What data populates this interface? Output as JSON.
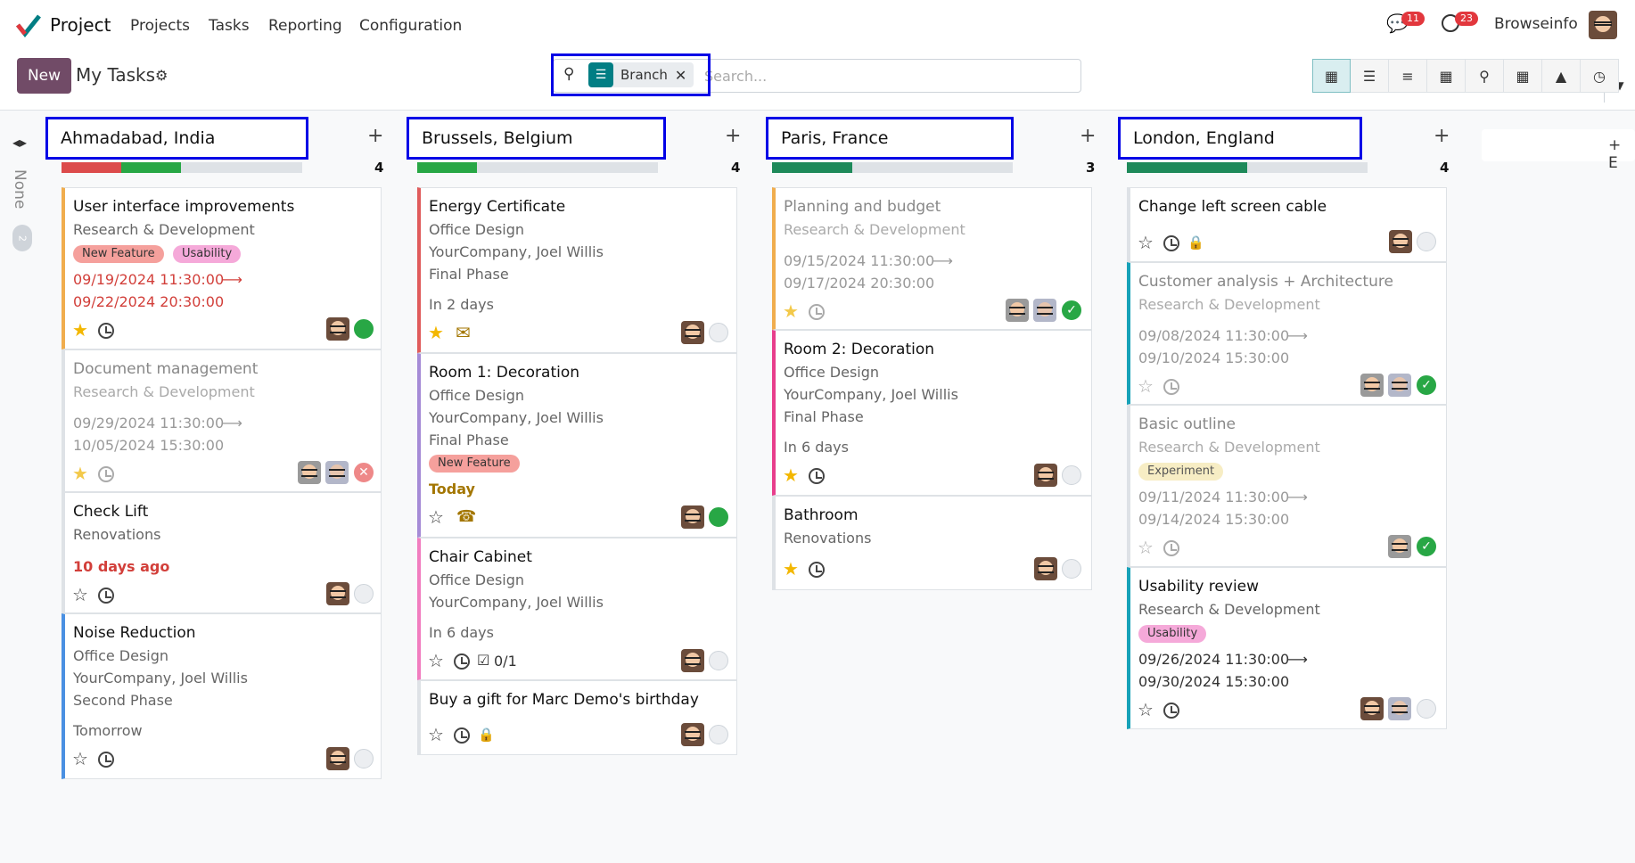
{
  "nav": {
    "app_name": "Project",
    "menu": [
      "Projects",
      "Tasks",
      "Reporting",
      "Configuration"
    ],
    "messages_count": "11",
    "activities_count": "23",
    "user": "Browseinfo"
  },
  "control": {
    "new_label": "New",
    "title": "My Tasks",
    "facet_label": "Branch",
    "search_placeholder": "Search...",
    "views": [
      "kanban",
      "list",
      "gantt",
      "calendar",
      "map",
      "pivot",
      "graph",
      "activity"
    ]
  },
  "none_column": {
    "label": "None",
    "count": "2"
  },
  "add_column_label": "+ E",
  "columns": [
    {
      "name": "Ahmadabad, India",
      "count": "4",
      "cards": [
        {
          "title": "User interface improvements",
          "lines": [
            "Research & Development"
          ],
          "tags": [
            "New Feature",
            "Usability"
          ],
          "date_start": "09/19/2024 11:30:00",
          "date_end": "09/22/2024 20:30:00"
        },
        {
          "title": "Document management",
          "lines": [
            "Research & Development"
          ],
          "date_start": "09/29/2024 11:30:00",
          "date_end": "10/05/2024 15:30:00"
        },
        {
          "title": "Check Lift",
          "lines": [
            "Renovations"
          ],
          "deadline": "10 days ago"
        },
        {
          "title": "Noise Reduction",
          "lines": [
            "Office Design",
            "YourCompany, Joel Willis",
            "Second Phase"
          ],
          "deadline": "Tomorrow"
        }
      ]
    },
    {
      "name": "Brussels, Belgium",
      "count": "4",
      "cards": [
        {
          "title": "Energy Certificate",
          "lines": [
            "Office Design",
            "YourCompany, Joel Willis",
            "Final Phase"
          ],
          "deadline": "In 2 days"
        },
        {
          "title": "Room 1: Decoration",
          "lines": [
            "Office Design",
            "YourCompany, Joel Willis",
            "Final Phase"
          ],
          "tags": [
            "New Feature"
          ],
          "deadline": "Today"
        },
        {
          "title": "Chair Cabinet",
          "lines": [
            "Office Design",
            "YourCompany, Joel Willis"
          ],
          "deadline": "In 6 days",
          "subtasks": "0/1"
        },
        {
          "title": "Buy a gift for Marc Demo's birthday"
        }
      ]
    },
    {
      "name": "Paris, France",
      "count": "3",
      "cards": [
        {
          "title": "Planning and budget",
          "lines": [
            "Research & Development"
          ],
          "date_start": "09/15/2024 11:30:00",
          "date_end": "09/17/2024 20:30:00"
        },
        {
          "title": "Room 2: Decoration",
          "lines": [
            "Office Design",
            "YourCompany, Joel Willis",
            "Final Phase"
          ],
          "deadline": "In 6 days"
        },
        {
          "title": "Bathroom",
          "lines": [
            "Renovations"
          ]
        }
      ]
    },
    {
      "name": "London, England",
      "count": "4",
      "cards": [
        {
          "title": "Change left screen cable"
        },
        {
          "title": "Customer analysis + Architecture",
          "lines": [
            "Research & Development"
          ],
          "date_start": "09/08/2024 11:30:00",
          "date_end": "09/10/2024 15:30:00"
        },
        {
          "title": "Basic outline",
          "lines": [
            "Research & Development"
          ],
          "tags": [
            "Experiment"
          ],
          "date_start": "09/11/2024 11:30:00",
          "date_end": "09/14/2024 15:30:00"
        },
        {
          "title": "Usability review",
          "lines": [
            "Research & Development"
          ],
          "tags": [
            "Usability"
          ],
          "date_start": "09/26/2024 11:30:00",
          "date_end": "09/30/2024 15:30:00"
        }
      ]
    }
  ],
  "colors": {
    "brand": "#714b67",
    "highlight": "#0000e6",
    "green": "#28a745",
    "red": "#d23f3a"
  }
}
